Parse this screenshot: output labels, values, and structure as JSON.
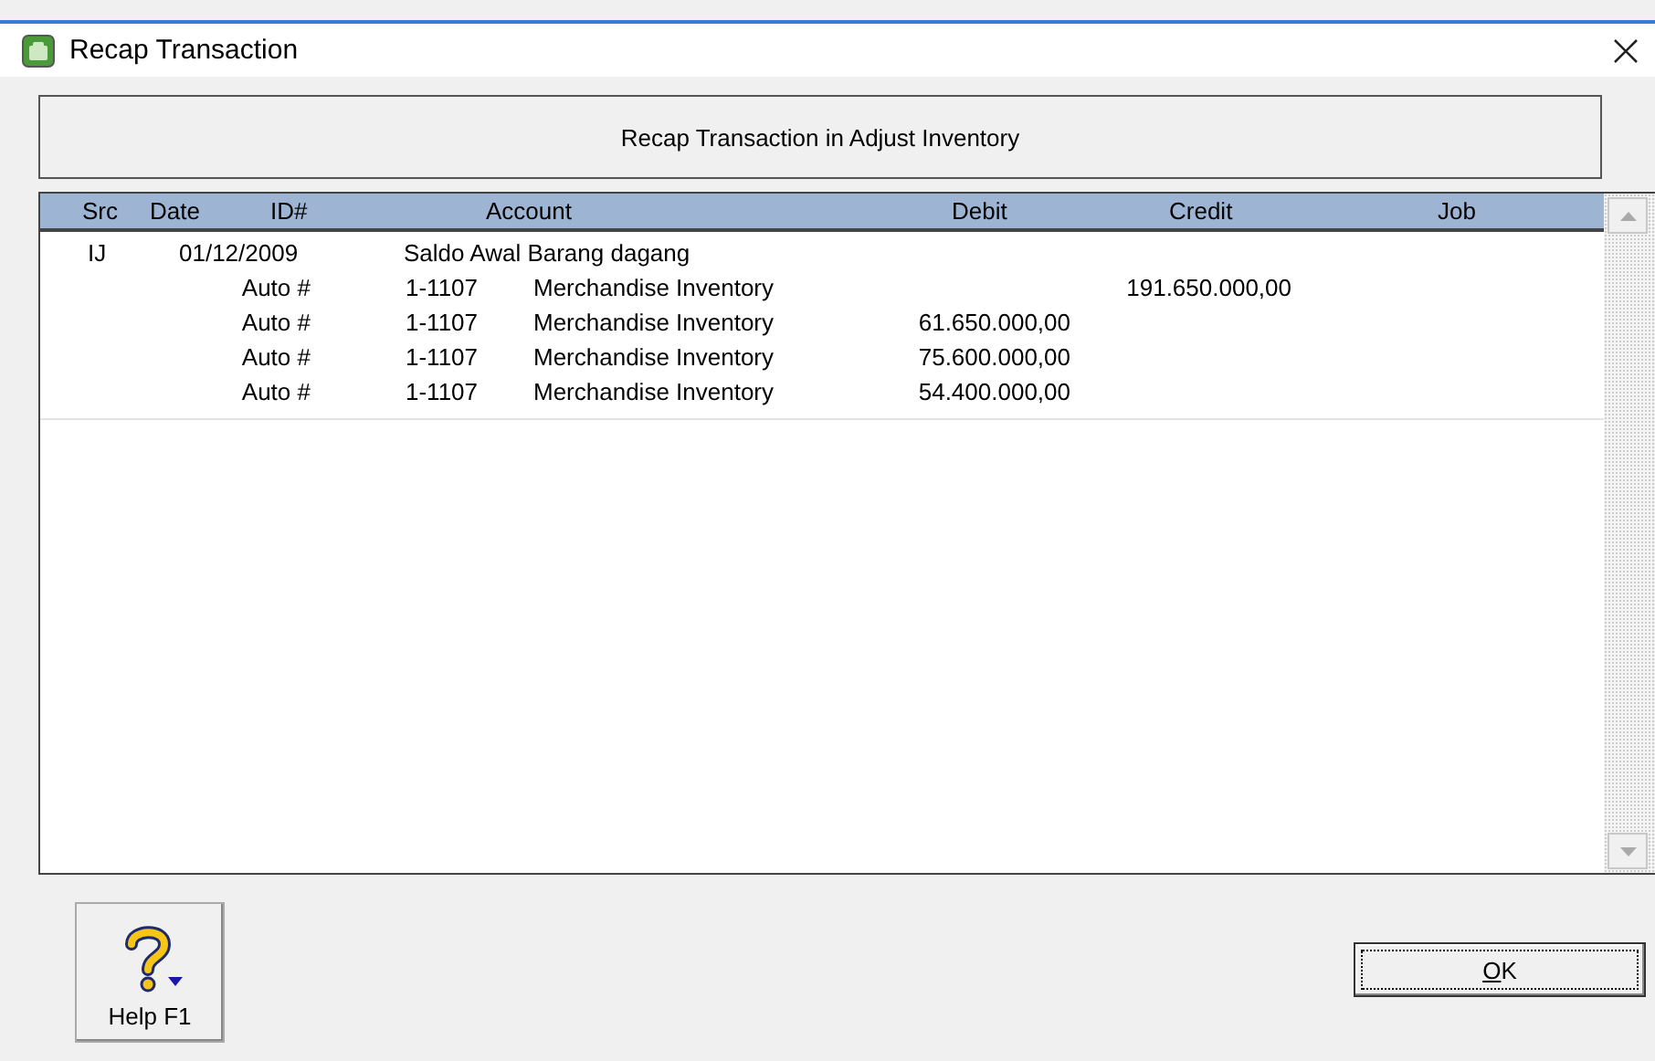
{
  "window": {
    "title": "Recap Transaction"
  },
  "heading": "Recap Transaction in Adjust Inventory",
  "table": {
    "columns": [
      "Src",
      "Date",
      "ID#",
      "Account",
      "Debit",
      "Credit",
      "Job"
    ],
    "rows": [
      {
        "kind": "entry",
        "src": "IJ",
        "date": "01/12/2009",
        "memo": "Saldo Awal Barang dagang"
      },
      {
        "kind": "line",
        "id": "Auto #",
        "account_no": "1-1107",
        "account_name": "Merchandise Inventory",
        "debit": "",
        "credit": "191.650.000,00"
      },
      {
        "kind": "line",
        "id": "Auto #",
        "account_no": "1-1107",
        "account_name": "Merchandise Inventory",
        "debit": "61.650.000,00",
        "credit": ""
      },
      {
        "kind": "line",
        "id": "Auto #",
        "account_no": "1-1107",
        "account_name": "Merchandise Inventory",
        "debit": "75.600.000,00",
        "credit": ""
      },
      {
        "kind": "line",
        "id": "Auto #",
        "account_no": "1-1107",
        "account_name": "Merchandise Inventory",
        "debit": "54.400.000,00",
        "credit": ""
      }
    ]
  },
  "buttons": {
    "help": "Help F1",
    "ok": "OK"
  }
}
